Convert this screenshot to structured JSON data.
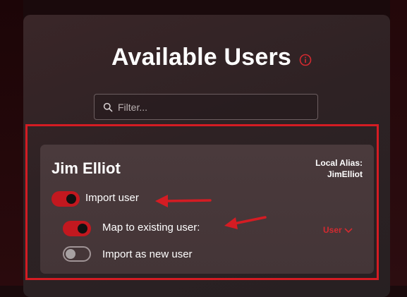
{
  "page": {
    "title": "Available Users"
  },
  "filter": {
    "placeholder": "Filter..."
  },
  "user": {
    "name": "Jim Elliot",
    "alias_label": "Local Alias:",
    "alias_value": "JimElliot"
  },
  "options": {
    "import_user": {
      "label": "Import user",
      "on": true
    },
    "map_existing": {
      "label": "Map to existing user:",
      "on": true
    },
    "import_new": {
      "label": "Import as new user",
      "on": false
    }
  },
  "role_dropdown": {
    "value": "User"
  },
  "colors": {
    "accent": "#d41c23",
    "toggle_on": "#c2181f",
    "panel": "#2e2224",
    "card": "#4a3a3c"
  },
  "icons": {
    "info": "info-circle-icon",
    "search": "search-icon",
    "dropdown": "chevron-down-icon",
    "annotation": "red-arrow-icon"
  }
}
